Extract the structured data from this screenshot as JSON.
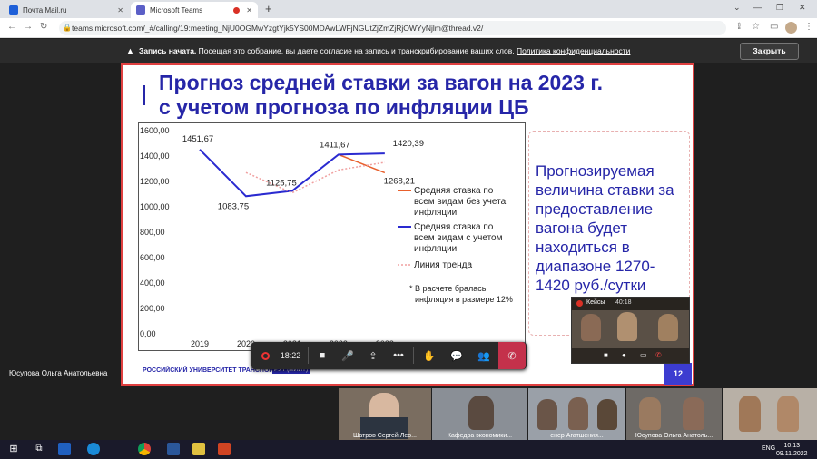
{
  "browser": {
    "tabs": [
      {
        "label": "Почта Mail.ru",
        "color": "#1e5fd8"
      },
      {
        "label": "Microsoft Teams",
        "color": "#5b5fc7"
      }
    ],
    "url": "teams.microsoft.com/_#/calling/19:meeting_NjU0OGMwYzgtYjk5YS00MDAwLWFjNGUtZjZmZjRjOWYyNjlm@thread.v2/"
  },
  "banner": {
    "bold": "Запись начата.",
    "text": "Посещая это собрание, вы даете согласие на запись и транскрибирование ваших слов.",
    "link": "Политика конфиденциальности",
    "close": "Закрыть"
  },
  "slide": {
    "title_line1": "Прогноз средней ставки за вагон на 2023 г.",
    "title_line2": "с учетом прогноза по инфляции ЦБ",
    "side_text": "Прогнозируемая величина ставки за предоставление вагона будет находиться в диапазоне 1270-1420 руб./сутки",
    "footer": "РОССИЙСКИЙ УНИВЕРСИТЕТ ТРАНСПОРТА",
    "footer_badge": "РУТ (МИИТ)",
    "number": "12",
    "note": "* В расчете бралась инфляция в размере 12%"
  },
  "chart_data": {
    "type": "line",
    "categories": [
      "2019",
      "2020",
      "2021",
      "2022",
      "2023"
    ],
    "ylim": [
      0,
      1600
    ],
    "y_ticks": [
      "0,00",
      "200,00",
      "400,00",
      "600,00",
      "800,00",
      "1000,00",
      "1200,00",
      "1400,00",
      "1600,00"
    ],
    "series": [
      {
        "name": "Средняя ставка по всем видам без учета инфляции",
        "color": "#e8602c",
        "values": [
          null,
          null,
          null,
          1411.67,
          1268.21
        ]
      },
      {
        "name": "Средняя ставка по всем видам с учетом инфляции",
        "color": "#2a2ad0",
        "values": [
          1451.67,
          1083.75,
          1125.75,
          1411.67,
          1420.39
        ]
      },
      {
        "name": "Линия тренда",
        "color": "#f0a0a0",
        "values": [
          null,
          1270,
          1110,
          1290,
          1350
        ]
      }
    ],
    "data_labels": [
      "1451,67",
      "1083,75",
      "1125,75",
      "1411,67",
      "1420,39",
      "1268,21"
    ]
  },
  "meeting": {
    "timer": "18:22",
    "presenter": "Юсупова Ольга Анатольевна",
    "self_label": "Кейсы",
    "self_time": "40:18"
  },
  "participants": [
    {
      "name": "Шатров Сергей Лео..."
    },
    {
      "name": "Кафедра экономики..."
    },
    {
      "name": "енер Агатшения..."
    },
    {
      "name": "Юсупова Ольга Анатоль..."
    },
    {
      "name": ""
    }
  ],
  "taskbar": {
    "lang": "ENG",
    "time": "10:13",
    "date": "09.11.2022"
  }
}
